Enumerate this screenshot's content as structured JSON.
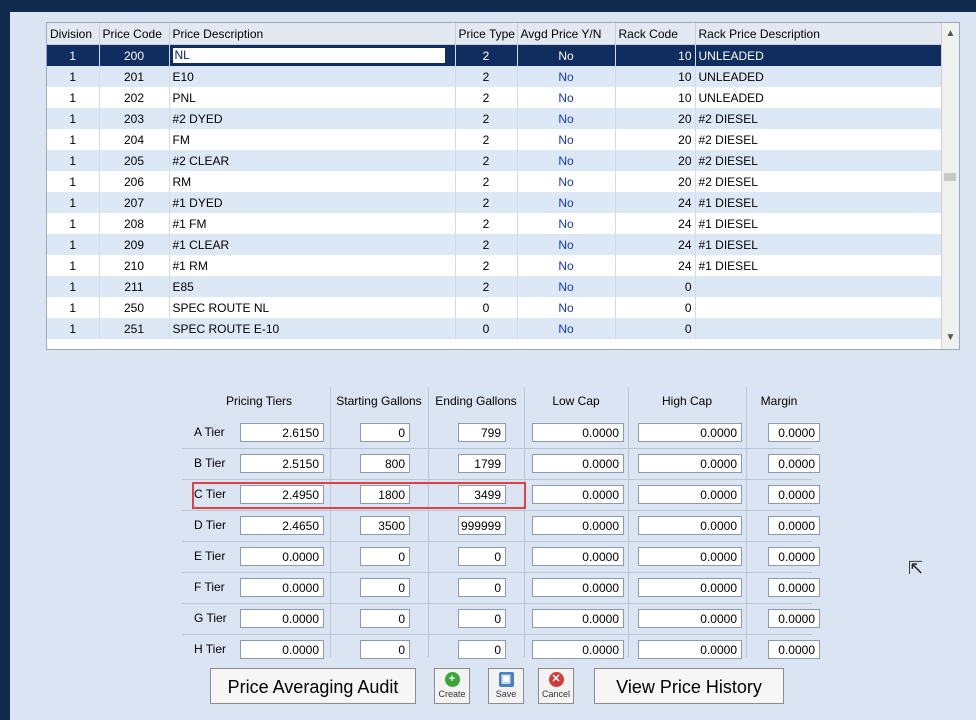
{
  "grid": {
    "columns": [
      "Division",
      "Price Code",
      "Price Description",
      "Price Type",
      "Avgd Price Y/N",
      "Rack Code",
      "Rack Price Description"
    ],
    "rows": [
      [
        "1",
        "200",
        "NL",
        "2",
        "No",
        "10",
        "UNLEADED"
      ],
      [
        "1",
        "201",
        "E10",
        "2",
        "No",
        "10",
        "UNLEADED"
      ],
      [
        "1",
        "202",
        "PNL",
        "2",
        "No",
        "10",
        "UNLEADED"
      ],
      [
        "1",
        "203",
        "#2 DYED",
        "2",
        "No",
        "20",
        "#2 DIESEL"
      ],
      [
        "1",
        "204",
        "FM",
        "2",
        "No",
        "20",
        "#2 DIESEL"
      ],
      [
        "1",
        "205",
        "#2 CLEAR",
        "2",
        "No",
        "20",
        "#2 DIESEL"
      ],
      [
        "1",
        "206",
        "RM",
        "2",
        "No",
        "20",
        "#2 DIESEL"
      ],
      [
        "1",
        "207",
        "#1 DYED",
        "2",
        "No",
        "24",
        "#1 DIESEL"
      ],
      [
        "1",
        "208",
        "#1 FM",
        "2",
        "No",
        "24",
        "#1 DIESEL"
      ],
      [
        "1",
        "209",
        "#1 CLEAR",
        "2",
        "No",
        "24",
        "#1 DIESEL"
      ],
      [
        "1",
        "210",
        "#1 RM",
        "2",
        "No",
        "24",
        "#1 DIESEL"
      ],
      [
        "1",
        "211",
        "E85",
        "2",
        "No",
        "0",
        ""
      ],
      [
        "1",
        "250",
        "SPEC ROUTE NL",
        "0",
        "No",
        "0",
        ""
      ],
      [
        "1",
        "251",
        "SPEC ROUTE E-10",
        "0",
        "No",
        "0",
        ""
      ]
    ],
    "selected_row": 0
  },
  "tiers": {
    "headers": [
      "Pricing Tiers",
      "Starting Gallons",
      "Ending Gallons",
      "Low Cap",
      "High Cap",
      "Margin"
    ],
    "rows": [
      {
        "label": "A Tier",
        "price": "2.6150",
        "start": "0",
        "end": "799",
        "low": "0.0000",
        "high": "0.0000",
        "margin": "0.0000"
      },
      {
        "label": "B Tier",
        "price": "2.5150",
        "start": "800",
        "end": "1799",
        "low": "0.0000",
        "high": "0.0000",
        "margin": "0.0000"
      },
      {
        "label": "C Tier",
        "price": "2.4950",
        "start": "1800",
        "end": "3499",
        "low": "0.0000",
        "high": "0.0000",
        "margin": "0.0000"
      },
      {
        "label": "D Tier",
        "price": "2.4650",
        "start": "3500",
        "end": "999999",
        "low": "0.0000",
        "high": "0.0000",
        "margin": "0.0000"
      },
      {
        "label": "E Tier",
        "price": "0.0000",
        "start": "0",
        "end": "0",
        "low": "0.0000",
        "high": "0.0000",
        "margin": "0.0000"
      },
      {
        "label": "F Tier",
        "price": "0.0000",
        "start": "0",
        "end": "0",
        "low": "0.0000",
        "high": "0.0000",
        "margin": "0.0000"
      },
      {
        "label": "G Tier",
        "price": "0.0000",
        "start": "0",
        "end": "0",
        "low": "0.0000",
        "high": "0.0000",
        "margin": "0.0000"
      },
      {
        "label": "H Tier",
        "price": "0.0000",
        "start": "0",
        "end": "0",
        "low": "0.0000",
        "high": "0.0000",
        "margin": "0.0000"
      }
    ]
  },
  "buttons": {
    "audit": "Price Averaging Audit",
    "create": "Create",
    "save": "Save",
    "cancel": "Cancel",
    "history": "View Price History"
  },
  "colors": {
    "selection": "#0f2d5e",
    "highlight_border": "#e24040",
    "no_text": "#1436c8"
  },
  "icons": [
    "scroll-up-icon",
    "scroll-down-icon",
    "create-icon",
    "save-icon",
    "cancel-icon",
    "mouse-cursor-icon"
  ]
}
